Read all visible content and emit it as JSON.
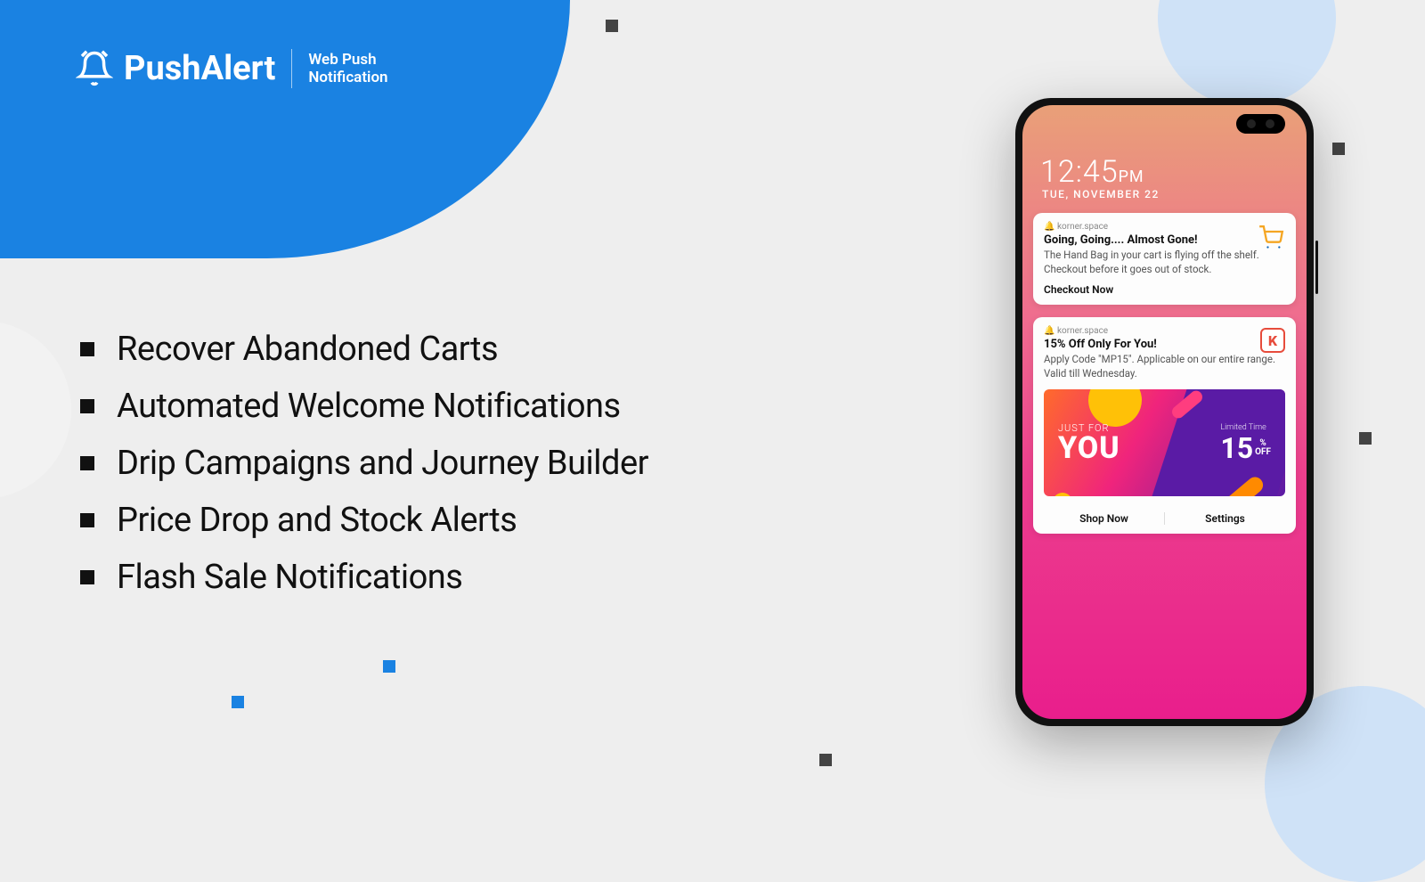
{
  "brand": {
    "name": "PushAlert",
    "subtitle_line1": "Web Push",
    "subtitle_line2": "Notification"
  },
  "features": [
    "Recover Abandoned Carts",
    "Automated Welcome Notifications",
    "Drip Campaigns and Journey Builder",
    "Price Drop and Stock Alerts",
    "Flash Sale Notifications"
  ],
  "phone": {
    "time": "12:45",
    "ampm": "PM",
    "date": "TUE, NOVEMBER 22",
    "notifications": [
      {
        "source": "korner.space",
        "title": "Going, Going.... Almost Gone!",
        "body": "The Hand Bag in your cart is flying off the shelf. Checkout before it goes out of stock.",
        "cta": "Checkout Now",
        "icon": "cart"
      },
      {
        "source": "korner.space",
        "title": "15% Off Only For You!",
        "body": "Apply Code \"MP15\". Applicable on our entire range. Valid till Wednesday.",
        "icon": "K",
        "promo": {
          "just": "JUST FOR",
          "you": "YOU",
          "limited": "Limited Time",
          "percent": "15",
          "pct_label_top": "%",
          "pct_label_bot": "OFF"
        },
        "actions": [
          "Shop Now",
          "Settings"
        ]
      }
    ]
  },
  "colors": {
    "brand_blue": "#1a82e2",
    "bg": "#eeeeee",
    "light_blue": "#cfe2f7"
  }
}
